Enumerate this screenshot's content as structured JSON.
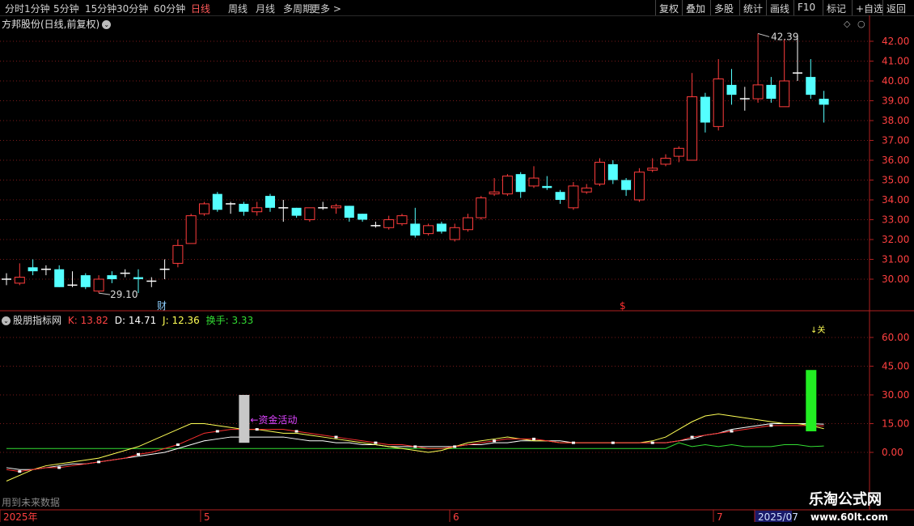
{
  "toolbar": {
    "periods": [
      "分时",
      "1分钟",
      "5分钟",
      "15分钟",
      "30分钟",
      "60分钟",
      "日线",
      "周线",
      "月线",
      "多周期",
      "更多 >"
    ],
    "active_period": "日线",
    "right_buttons": [
      "复权",
      "叠加",
      "多股",
      "统计",
      "画线",
      "F10",
      "标记",
      "+自选",
      "返回"
    ]
  },
  "main_chart": {
    "title": "方邦股份(日线,前复权)",
    "high_label": "42.39",
    "low_label": "29.10",
    "marker_cai": "财",
    "marker_s": "$",
    "price_axis": [
      "42.00",
      "41.00",
      "40.00",
      "39.00",
      "38.00",
      "37.00",
      "36.00",
      "35.00",
      "34.00",
      "33.00",
      "32.00",
      "31.00",
      "30.00"
    ]
  },
  "indicator": {
    "name": "股朋指标网",
    "k_label": "K: 13.82",
    "d_label": "D: 14.71",
    "j_label": "J: 12.36",
    "turnover_label": "换手: 3.33",
    "annotation": "资金活动",
    "top_mark": "↓关",
    "axis": [
      "60.00",
      "45.00",
      "30.00",
      "15.00",
      "0.00"
    ],
    "future_note": "用到未来数据"
  },
  "date_axis": {
    "labels": [
      "2025年",
      "5",
      "6",
      "7",
      "2025/07"
    ]
  },
  "watermark": {
    "line1": "乐淘公式网",
    "line2": "www.60lt.com"
  },
  "colors": {
    "up": "#ff3c3c",
    "down": "#54ffff",
    "k": "#ffffff",
    "d": "#ffff55",
    "j": "#ff3030",
    "turnover": "#33dd33"
  },
  "chart_data": {
    "type": "candlestick",
    "price_range": [
      29.0,
      42.8
    ],
    "candles": [
      {
        "o": 30.0,
        "c": 30.0,
        "h": 30.3,
        "l": 29.7
      },
      {
        "o": 29.8,
        "c": 30.1,
        "h": 30.8,
        "l": 29.7
      },
      {
        "o": 30.6,
        "c": 30.4,
        "h": 31.0,
        "l": 30.2
      },
      {
        "o": 30.5,
        "c": 30.5,
        "h": 30.7,
        "l": 30.2
      },
      {
        "o": 30.5,
        "c": 29.6,
        "h": 30.7,
        "l": 29.6
      },
      {
        "o": 29.7,
        "c": 29.7,
        "h": 30.4,
        "l": 29.6
      },
      {
        "o": 30.2,
        "c": 29.6,
        "h": 30.3,
        "l": 29.5
      },
      {
        "o": 29.4,
        "c": 30.0,
        "h": 30.2,
        "l": 29.3
      },
      {
        "o": 30.2,
        "c": 30.0,
        "h": 30.4,
        "l": 29.8
      },
      {
        "o": 30.3,
        "c": 30.3,
        "h": 30.5,
        "l": 30.1
      },
      {
        "o": 30.1,
        "c": 30.0,
        "h": 30.5,
        "l": 29.3
      },
      {
        "o": 29.9,
        "c": 29.9,
        "h": 30.1,
        "l": 29.6
      },
      {
        "o": 30.5,
        "c": 30.5,
        "h": 31.0,
        "l": 30.0
      },
      {
        "o": 30.8,
        "c": 31.7,
        "h": 32.0,
        "l": 30.6
      },
      {
        "o": 31.8,
        "c": 33.2,
        "h": 33.3,
        "l": 31.8
      },
      {
        "o": 33.3,
        "c": 33.8,
        "h": 33.9,
        "l": 33.2
      },
      {
        "o": 34.3,
        "c": 33.5,
        "h": 34.4,
        "l": 33.4
      },
      {
        "o": 33.8,
        "c": 33.8,
        "h": 33.9,
        "l": 33.3
      },
      {
        "o": 33.8,
        "c": 33.4,
        "h": 33.9,
        "l": 33.2
      },
      {
        "o": 33.4,
        "c": 33.6,
        "h": 33.9,
        "l": 33.2
      },
      {
        "o": 34.2,
        "c": 33.6,
        "h": 34.3,
        "l": 33.4
      },
      {
        "o": 33.6,
        "c": 33.6,
        "h": 34.0,
        "l": 32.9
      },
      {
        "o": 33.6,
        "c": 33.2,
        "h": 33.6,
        "l": 33.1
      },
      {
        "o": 33.0,
        "c": 33.6,
        "h": 33.6,
        "l": 32.9
      },
      {
        "o": 33.6,
        "c": 33.6,
        "h": 33.9,
        "l": 33.5
      },
      {
        "o": 33.6,
        "c": 33.7,
        "h": 33.8,
        "l": 33.3
      },
      {
        "o": 33.7,
        "c": 33.1,
        "h": 33.7,
        "l": 32.9
      },
      {
        "o": 33.3,
        "c": 33.0,
        "h": 33.3,
        "l": 32.9
      },
      {
        "o": 32.7,
        "c": 32.7,
        "h": 32.9,
        "l": 32.6
      },
      {
        "o": 32.6,
        "c": 33.0,
        "h": 33.2,
        "l": 32.5
      },
      {
        "o": 32.8,
        "c": 33.2,
        "h": 33.3,
        "l": 32.7
      },
      {
        "o": 32.8,
        "c": 32.2,
        "h": 33.6,
        "l": 32.1
      },
      {
        "o": 32.3,
        "c": 32.7,
        "h": 32.8,
        "l": 32.2
      },
      {
        "o": 32.8,
        "c": 32.4,
        "h": 32.9,
        "l": 32.3
      },
      {
        "o": 32.0,
        "c": 32.6,
        "h": 32.8,
        "l": 31.9
      },
      {
        "o": 32.5,
        "c": 33.1,
        "h": 33.3,
        "l": 32.4
      },
      {
        "o": 33.1,
        "c": 34.1,
        "h": 34.2,
        "l": 33.0
      },
      {
        "o": 34.3,
        "c": 34.4,
        "h": 35.1,
        "l": 34.2
      },
      {
        "o": 34.3,
        "c": 35.2,
        "h": 35.3,
        "l": 34.2
      },
      {
        "o": 35.3,
        "c": 34.4,
        "h": 35.4,
        "l": 34.1
      },
      {
        "o": 34.7,
        "c": 35.1,
        "h": 35.7,
        "l": 34.6
      },
      {
        "o": 34.7,
        "c": 34.6,
        "h": 35.2,
        "l": 34.5
      },
      {
        "o": 34.4,
        "c": 34.0,
        "h": 34.5,
        "l": 33.8
      },
      {
        "o": 33.6,
        "c": 34.7,
        "h": 34.9,
        "l": 33.5
      },
      {
        "o": 34.4,
        "c": 34.6,
        "h": 34.8,
        "l": 34.3
      },
      {
        "o": 34.8,
        "c": 35.9,
        "h": 36.1,
        "l": 34.7
      },
      {
        "o": 35.8,
        "c": 35.0,
        "h": 36.0,
        "l": 34.8
      },
      {
        "o": 35.0,
        "c": 34.5,
        "h": 35.1,
        "l": 34.2
      },
      {
        "o": 34.0,
        "c": 35.4,
        "h": 35.6,
        "l": 33.9
      },
      {
        "o": 35.5,
        "c": 35.6,
        "h": 36.1,
        "l": 35.4
      },
      {
        "o": 35.8,
        "c": 36.1,
        "h": 36.3,
        "l": 35.7
      },
      {
        "o": 36.2,
        "c": 36.6,
        "h": 36.7,
        "l": 35.9
      },
      {
        "o": 36.0,
        "c": 39.2,
        "h": 40.4,
        "l": 36.0
      },
      {
        "o": 39.2,
        "c": 37.9,
        "h": 39.4,
        "l": 37.4
      },
      {
        "o": 37.7,
        "c": 40.1,
        "h": 41.1,
        "l": 37.5
      },
      {
        "o": 39.8,
        "c": 39.3,
        "h": 40.6,
        "l": 38.8
      },
      {
        "o": 39.1,
        "c": 39.1,
        "h": 39.7,
        "l": 38.5
      },
      {
        "o": 39.1,
        "c": 39.8,
        "h": 42.39,
        "l": 38.9
      },
      {
        "o": 39.8,
        "c": 39.1,
        "h": 40.2,
        "l": 38.9
      },
      {
        "o": 38.7,
        "c": 40.0,
        "h": 42.1,
        "l": 38.7
      },
      {
        "o": 40.4,
        "c": 40.4,
        "h": 42.2,
        "l": 40.0
      },
      {
        "o": 40.2,
        "c": 39.3,
        "h": 41.1,
        "l": 39.1
      },
      {
        "o": 39.1,
        "c": 38.8,
        "h": 39.5,
        "l": 37.9
      }
    ],
    "indicator_range": [
      -10,
      70
    ],
    "indicator_k": [
      -9,
      -10,
      -9,
      -8,
      -8,
      -7,
      -6,
      -5,
      -4,
      -3,
      -1,
      0,
      2,
      4,
      7,
      10,
      11,
      12,
      12,
      12,
      12,
      12,
      11,
      10,
      9,
      8,
      7,
      6,
      5,
      4,
      4,
      3,
      2,
      2,
      3,
      4,
      5,
      6,
      7,
      7,
      7,
      6,
      5,
      5,
      5,
      5,
      5,
      5,
      5,
      5,
      5,
      6,
      8,
      9,
      10,
      11,
      12,
      13,
      14,
      14,
      14,
      14,
      13.82
    ],
    "indicator_d": [
      -8,
      -9,
      -9,
      -8,
      -7,
      -6,
      -6,
      -5,
      -4,
      -3,
      -2,
      -1,
      0,
      2,
      4,
      6,
      7,
      8,
      8,
      8,
      8,
      8,
      7,
      6,
      6,
      5,
      5,
      4,
      4,
      3,
      3,
      3,
      3,
      3,
      3,
      4,
      4,
      5,
      5,
      6,
      6,
      6,
      6,
      5,
      5,
      5,
      5,
      5,
      5,
      5,
      5,
      6,
      7,
      9,
      10,
      12,
      13,
      14,
      15,
      15,
      15,
      15,
      14.71
    ],
    "indicator_j": [
      -15,
      -12,
      -9,
      -7,
      -6,
      -5,
      -4,
      -3,
      -1,
      1,
      3,
      6,
      9,
      12,
      15,
      15,
      14,
      13,
      12,
      12,
      11,
      10,
      10,
      9,
      8,
      7,
      6,
      5,
      4,
      3,
      2,
      1,
      0,
      1,
      3,
      5,
      6,
      7,
      8,
      7,
      6,
      6,
      5,
      5,
      5,
      5,
      5,
      5,
      5,
      6,
      8,
      12,
      16,
      19,
      20,
      19,
      18,
      17,
      16,
      15,
      15,
      14,
      12.36
    ],
    "turnover": [
      2,
      2,
      2,
      2,
      2,
      2,
      2,
      2,
      2,
      2,
      2,
      2,
      2,
      2,
      2,
      2,
      2,
      2,
      2,
      2,
      2,
      2,
      2,
      2,
      2,
      2,
      2,
      2,
      2,
      2,
      2,
      2,
      2,
      2,
      2,
      2,
      2,
      2,
      2,
      2,
      2,
      2,
      2,
      2,
      2,
      2,
      2,
      2,
      2,
      2,
      2,
      5,
      3,
      4,
      3,
      4,
      3,
      3,
      3,
      4,
      4,
      3,
      3.33
    ],
    "bars": [
      {
        "index": 18,
        "from": 5,
        "to": 30,
        "color": "grey"
      },
      {
        "index": 61,
        "from": 11,
        "to": 43,
        "color": "green"
      }
    ]
  }
}
